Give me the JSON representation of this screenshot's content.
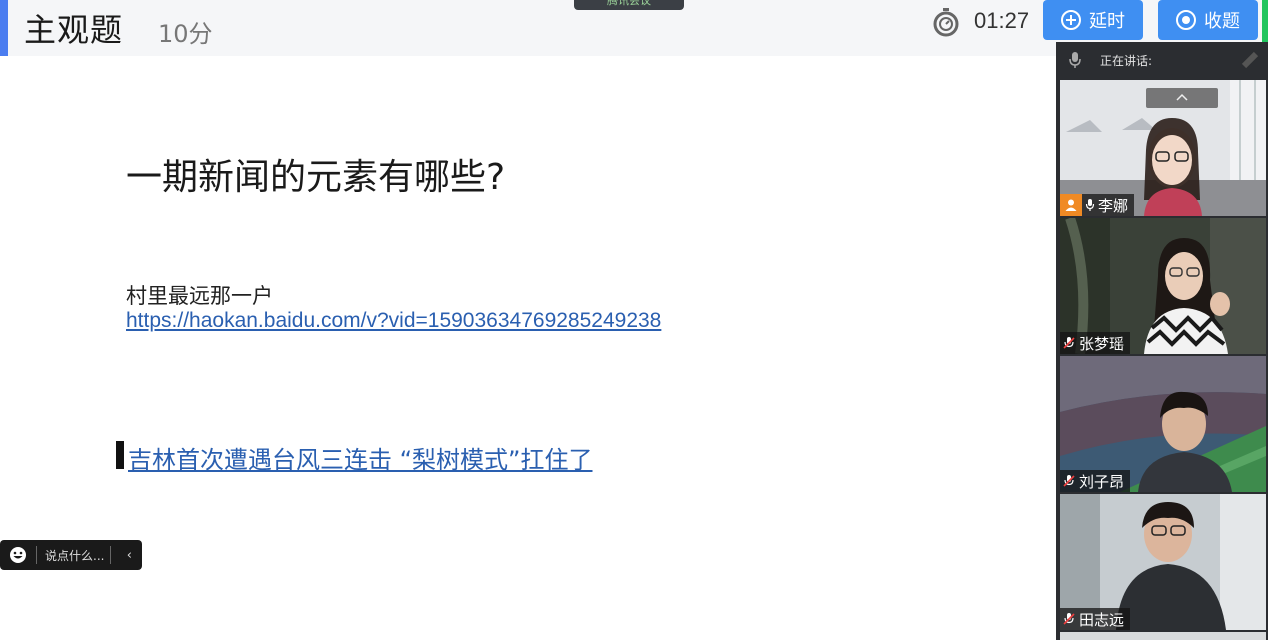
{
  "header": {
    "title": "主观题",
    "score": "10分",
    "meeting_app": "腾讯会议",
    "timer": "01:27",
    "extend_label": "延时",
    "collect_label": "收题",
    "accent_color": "#4b7df0",
    "button_color": "#3f8ff2"
  },
  "slide": {
    "heading": "一期新闻的元素有哪些?",
    "text_line": "村里最远那一户",
    "link_url": "https://haokan.baidu.com/v?vid=15903634769285249238",
    "link2_text": "吉林首次遭遇台风三连击 “梨树模式”扛住了",
    "link_color": "#2a5fb0"
  },
  "chat": {
    "placeholder": "说点什么...",
    "chevron_icon": "chevron-left-icon",
    "emoji_icon": "smile-icon"
  },
  "panel": {
    "speaking_label": "正在讲话:",
    "participants": [
      {
        "name": "李娜",
        "host": true,
        "muted": false
      },
      {
        "name": "张梦瑶",
        "host": false,
        "muted": true
      },
      {
        "name": "刘子昂",
        "host": false,
        "muted": true
      },
      {
        "name": "田志远",
        "host": false,
        "muted": true
      }
    ]
  }
}
